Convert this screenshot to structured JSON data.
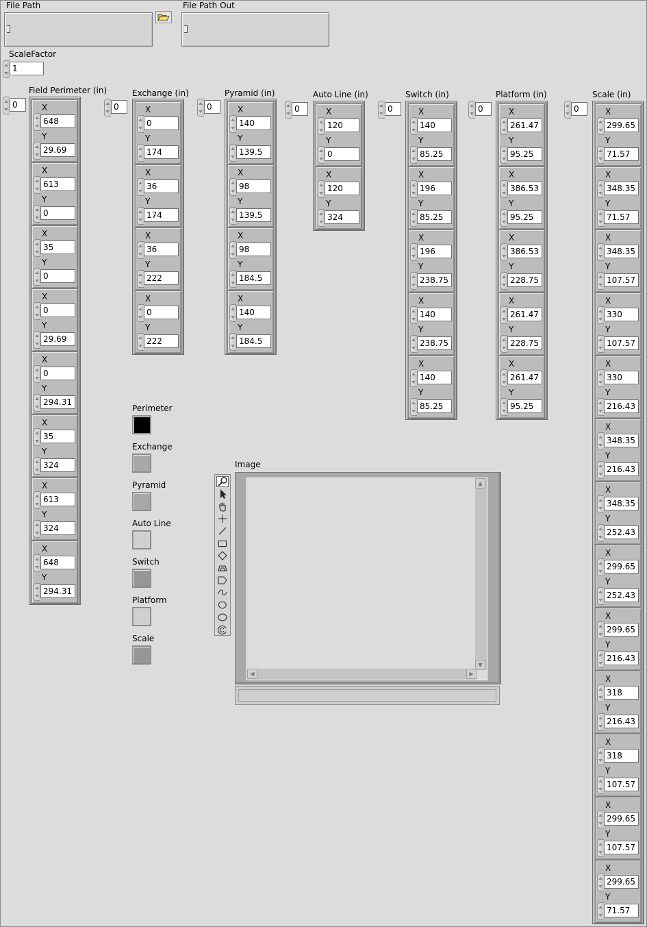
{
  "file_path": {
    "label": "File Path",
    "value": ""
  },
  "file_path_out": {
    "label": "File Path Out",
    "value": ""
  },
  "scale_factor": {
    "label": "ScaleFactor",
    "value": "1"
  },
  "arrays": [
    {
      "label": "Field Perimeter (in)",
      "index": "0",
      "points": [
        {
          "x": "648",
          "y": "29.69"
        },
        {
          "x": "613",
          "y": "0"
        },
        {
          "x": "35",
          "y": "0"
        },
        {
          "x": "0",
          "y": "29.69"
        },
        {
          "x": "0",
          "y": "294.31"
        },
        {
          "x": "35",
          "y": "324"
        },
        {
          "x": "613",
          "y": "324"
        },
        {
          "x": "648",
          "y": "294.31"
        }
      ]
    },
    {
      "label": "Exchange (in)",
      "index": "0",
      "points": [
        {
          "x": "0",
          "y": "174"
        },
        {
          "x": "36",
          "y": "174"
        },
        {
          "x": "36",
          "y": "222"
        },
        {
          "x": "0",
          "y": "222"
        }
      ]
    },
    {
      "label": "Pyramid (in)",
      "index": "0",
      "points": [
        {
          "x": "140",
          "y": "139.5"
        },
        {
          "x": "98",
          "y": "139.5"
        },
        {
          "x": "98",
          "y": "184.5"
        },
        {
          "x": "140",
          "y": "184.5"
        }
      ]
    },
    {
      "label": "Auto Line (in)",
      "index": "0",
      "points": [
        {
          "x": "120",
          "y": "0"
        },
        {
          "x": "120",
          "y": "324"
        }
      ]
    },
    {
      "label": "Switch (in)",
      "index": "0",
      "points": [
        {
          "x": "140",
          "y": "85.25"
        },
        {
          "x": "196",
          "y": "85.25"
        },
        {
          "x": "196",
          "y": "238.75"
        },
        {
          "x": "140",
          "y": "238.75"
        },
        {
          "x": "140",
          "y": "85.25"
        }
      ]
    },
    {
      "label": "Platform (in)",
      "index": "0",
      "points": [
        {
          "x": "261.47",
          "y": "95.25"
        },
        {
          "x": "386.53",
          "y": "95.25"
        },
        {
          "x": "386.53",
          "y": "228.75"
        },
        {
          "x": "261.47",
          "y": "228.75"
        },
        {
          "x": "261.47",
          "y": "95.25"
        }
      ]
    },
    {
      "label": "Scale (in)",
      "index": "0",
      "points": [
        {
          "x": "299.65",
          "y": "71.57"
        },
        {
          "x": "348.35",
          "y": "71.57"
        },
        {
          "x": "348.35",
          "y": "107.57"
        },
        {
          "x": "330",
          "y": "107.57"
        },
        {
          "x": "330",
          "y": "216.43"
        },
        {
          "x": "348.35",
          "y": "216.43"
        },
        {
          "x": "348.35",
          "y": "252.43"
        },
        {
          "x": "299.65",
          "y": "252.43"
        },
        {
          "x": "299.65",
          "y": "216.43"
        },
        {
          "x": "318",
          "y": "216.43"
        },
        {
          "x": "318",
          "y": "107.57"
        },
        {
          "x": "299.65",
          "y": "107.57"
        },
        {
          "x": "299.65",
          "y": "71.57"
        }
      ]
    }
  ],
  "cluster_labels": {
    "x": "X",
    "y": "Y"
  },
  "colors": [
    {
      "label": "Perimeter",
      "color": "#000000"
    },
    {
      "label": "Exchange",
      "color": "#a8a8a8"
    },
    {
      "label": "Pyramid",
      "color": "#a8a8a8"
    },
    {
      "label": "Auto Line",
      "color": "#d0d0d0"
    },
    {
      "label": "Switch",
      "color": "#969696"
    },
    {
      "label": "Platform",
      "color": "#d0d0d0"
    },
    {
      "label": "Scale",
      "color": "#969696"
    }
  ],
  "image": {
    "label": "Image"
  },
  "tools": [
    "zoom-icon",
    "pointer-icon",
    "pan-hand-icon",
    "crosshair-point-icon",
    "line-icon",
    "rectangle-icon",
    "rotated-rectangle-icon",
    "annulus-icon",
    "polygon-icon",
    "freehand-icon",
    "free-region-icon",
    "oval-icon",
    "broken-annulus-icon"
  ]
}
